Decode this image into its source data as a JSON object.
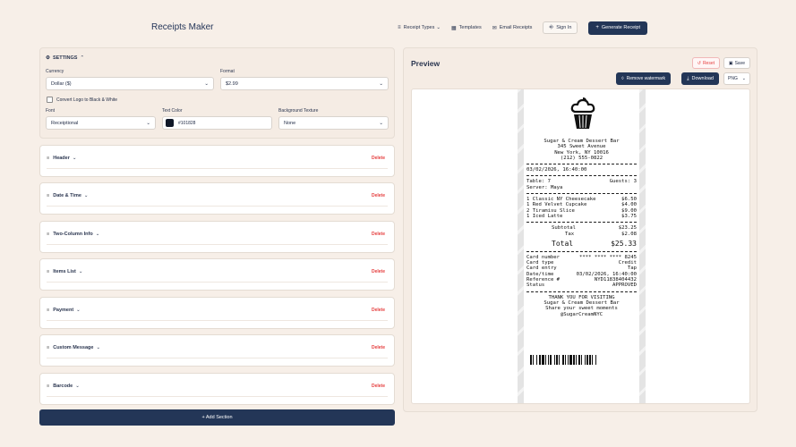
{
  "header": {
    "app_title": "Receipts Maker",
    "nav": {
      "receipt_types": "Receipt Types",
      "templates": "Templates",
      "email_receipts": "Email Receipts",
      "sign_in": "Sign In",
      "generate_receipt": "Generate Receipt"
    }
  },
  "settings": {
    "title": "SETTINGS",
    "currency_label": "Currency",
    "currency_value": "Dollar ($)",
    "format_label": "Format",
    "format_value": "$2.99",
    "convert_logo_label": "Convert Logo to Black & White",
    "font_label": "Font",
    "font_value": "Receiptional",
    "text_color_label": "Text Color",
    "text_color_value": "#101828",
    "bg_texture_label": "Background Texture",
    "bg_texture_value": "None"
  },
  "sections": [
    {
      "title": "Header",
      "delete": "Delete"
    },
    {
      "title": "Date & Time",
      "delete": "Delete"
    },
    {
      "title": "Two-Column Info",
      "delete": "Delete"
    },
    {
      "title": "Items List",
      "delete": "Delete"
    },
    {
      "title": "Payment",
      "delete": "Delete"
    },
    {
      "title": "Custom Message",
      "delete": "Delete"
    },
    {
      "title": "Barcode",
      "delete": "Delete"
    }
  ],
  "add_section": "+ Add Section",
  "preview": {
    "title": "Preview",
    "reset": "Reset",
    "save": "Save",
    "remove_watermark": "Remove watermark",
    "download": "Download",
    "format": "PNG"
  },
  "receipt": {
    "store_name": "Sugar & Cream Dessert Bar",
    "address1": "345 Sweet Avenue",
    "address2": "New York, NY 10016",
    "phone": "(212) 555-0822",
    "datetime": "03/02/2026, 16:40:00",
    "table": "Table: 7",
    "guests": "Guests: 3",
    "server": "Server: Maya",
    "items": [
      {
        "name": "1 Classic NY Cheesecake",
        "price": "$6.50"
      },
      {
        "name": "1 Red Velvet Cupcake",
        "price": "$4.00"
      },
      {
        "name": "2 Tiramisu Slice",
        "price": "$9.00"
      },
      {
        "name": "1 Iced Latte",
        "price": "$3.75"
      }
    ],
    "subtotal_label": "Subtotal",
    "subtotal_value": "$23.25",
    "tax_label": "Tax",
    "tax_value": "$2.08",
    "total_label": "Total",
    "total_value": "$25.33",
    "payment": [
      {
        "label": "Card number",
        "value": "**** **** **** 8245"
      },
      {
        "label": "Card type",
        "value": "Credit"
      },
      {
        "label": "Card entry",
        "value": "Tap"
      },
      {
        "label": "Date/time",
        "value": "03/02/2026, 16:40:00"
      },
      {
        "label": "Reference #",
        "value": "NYD11838404432"
      },
      {
        "label": "Status",
        "value": "APPROVED"
      }
    ],
    "message1": "THANK YOU FOR VISITING",
    "message2": "Sugar & Cream Dessert Bar",
    "message3": "Share your sweet moments",
    "message4": "@SugarCreamNYC"
  },
  "colors": {
    "accent": "#233657",
    "danger": "#e53e3e",
    "background": "#f7efe8",
    "text_color": "#101828"
  }
}
